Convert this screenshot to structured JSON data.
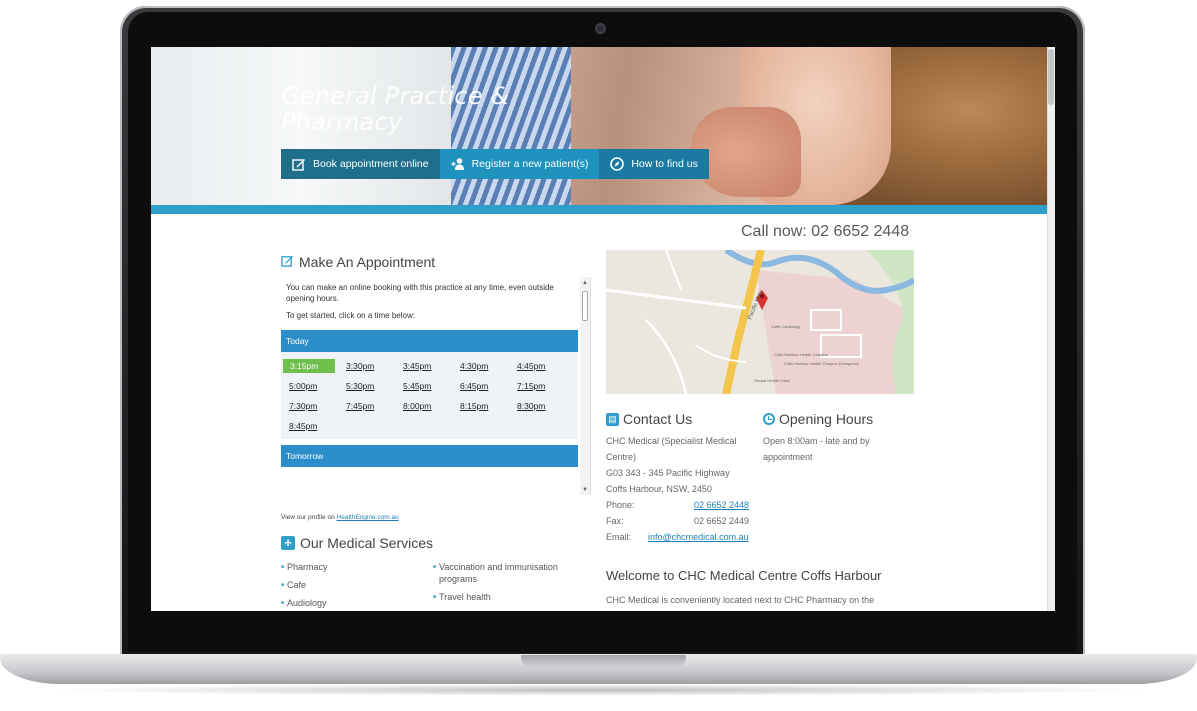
{
  "hero": {
    "title": "General Practice & Pharmacy",
    "nav": [
      {
        "label": "Book appointment online",
        "icon": "edit-icon"
      },
      {
        "label": "Register a new patient(s)",
        "icon": "add-user-icon"
      },
      {
        "label": "How to find us",
        "icon": "compass-icon"
      }
    ]
  },
  "call_now": "Call now: 02 6652 2448",
  "appointment": {
    "title": "Make An Appointment",
    "intro": "You can make an online booking with this practice at any time, even outside opening hours.",
    "instruction": "To get started, click on a time below:",
    "days": [
      {
        "label": "Today",
        "slots": [
          "3:15pm",
          "3:30pm",
          "3:45pm",
          "4:30pm",
          "4:45pm",
          "5:00pm",
          "5:30pm",
          "5:45pm",
          "6:45pm",
          "7:15pm",
          "7:30pm",
          "7:45pm",
          "8:00pm",
          "8:15pm",
          "8:30pm",
          "8:45pm"
        ],
        "selected": "3:15pm"
      },
      {
        "label": "Tomorrow"
      }
    ]
  },
  "profile": {
    "prefix": "View our profile on",
    "link": "HealthEngine.com.au"
  },
  "services": {
    "title": "Our Medical Services",
    "left": [
      "Pharmacy",
      "Cafe",
      "Audiology"
    ],
    "right": [
      "Vaccination and immunisation programs",
      "Travel health"
    ]
  },
  "contact": {
    "title": "Contact Us",
    "name": "CHC Medical (Specialist Medical Centre)",
    "address1": "G03 343 - 345 Pacific Highway",
    "address2": "Coffs Harbour, NSW, 2450",
    "phone_label": "Phone:",
    "phone": "02 6652 2448",
    "fax_label": "Fax:",
    "fax": "02 6652 2449",
    "email_label": "Email:",
    "email": "info@chcmedical.com.au"
  },
  "hours": {
    "title": "Opening Hours",
    "text": "Open 8:00am - late and by appointment"
  },
  "welcome": {
    "title": "Welcome to CHC Medical Centre Coffs Harbour",
    "text": "CHC Medical is conveniently located next to CHC Pharmacy on the"
  },
  "map": {
    "labels": [
      "Pacific Hwy",
      "Coffs Harbour Health Campus",
      "Coffs Cardiology",
      "Coffs Harbour Health Campus Emergency",
      "Sexual Health Clinic"
    ]
  },
  "colors": {
    "accent": "#2f9ec9",
    "nav_dark": "#1f6f8c",
    "nav_mid": "#1f93be",
    "slot_selected": "#6ebf4b",
    "day_bar": "#2b8ecb"
  }
}
